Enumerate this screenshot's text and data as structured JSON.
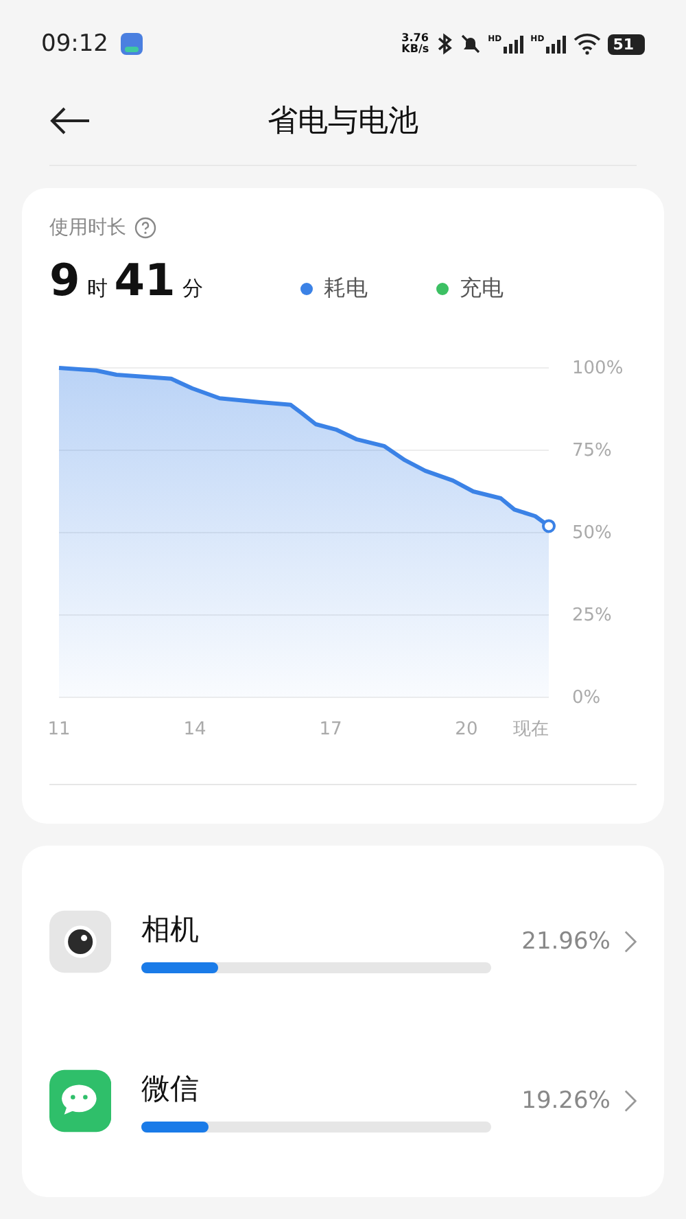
{
  "status_bar": {
    "time": "09:12",
    "speed_value": "3.76",
    "speed_unit": "KB/s",
    "signal_labels": [
      "HD",
      "HD"
    ],
    "battery": "51"
  },
  "header": {
    "title": "省电与电池"
  },
  "usage": {
    "label": "使用时长",
    "hours": "9",
    "hours_unit": "时",
    "minutes": "41",
    "minutes_unit": "分",
    "chart_data": {
      "type": "area",
      "grid": true,
      "x": [
        11,
        11.82,
        12.27,
        13.48,
        13.94,
        14.55,
        15.45,
        16.12,
        16.36,
        16.67,
        17.12,
        17.58,
        18.18,
        18.64,
        19.09,
        19.7,
        20.15,
        20.76,
        21.06,
        21.52,
        21.82
      ],
      "series": [
        {
          "name": "耗电",
          "color": "#3b82e6",
          "values": [
            100,
            99.2,
            97.9,
            96.7,
            93.8,
            90.8,
            89.6,
            88.8,
            86.3,
            82.9,
            81.3,
            78.3,
            76.3,
            72,
            68.8,
            65.8,
            62.5,
            60.4,
            57,
            55,
            52
          ]
        },
        {
          "name": "充电",
          "color": "#3cc063",
          "values": [
            null,
            null,
            null,
            null,
            null,
            null,
            null,
            null,
            null,
            null,
            null,
            null,
            null,
            null,
            null,
            null,
            null,
            null,
            null,
            null,
            null
          ]
        }
      ],
      "xlim": [
        11,
        21.82
      ],
      "ylim": [
        0,
        100
      ],
      "xticks": [
        11,
        14,
        17,
        20,
        {
          "value": 21.82,
          "label": "现在"
        }
      ],
      "yticks": [
        {
          "value": 0,
          "label": "0%"
        },
        {
          "value": 25,
          "label": "25%"
        },
        {
          "value": 50,
          "label": "50%"
        },
        {
          "value": 75,
          "label": "75%"
        },
        {
          "value": 100,
          "label": "100%"
        }
      ]
    }
  },
  "apps": [
    {
      "name": "相机",
      "percent": "21.96%",
      "level": 0.22,
      "kind": "camera"
    },
    {
      "name": "微信",
      "percent": "19.26%",
      "level": 0.19,
      "kind": "chat"
    }
  ]
}
